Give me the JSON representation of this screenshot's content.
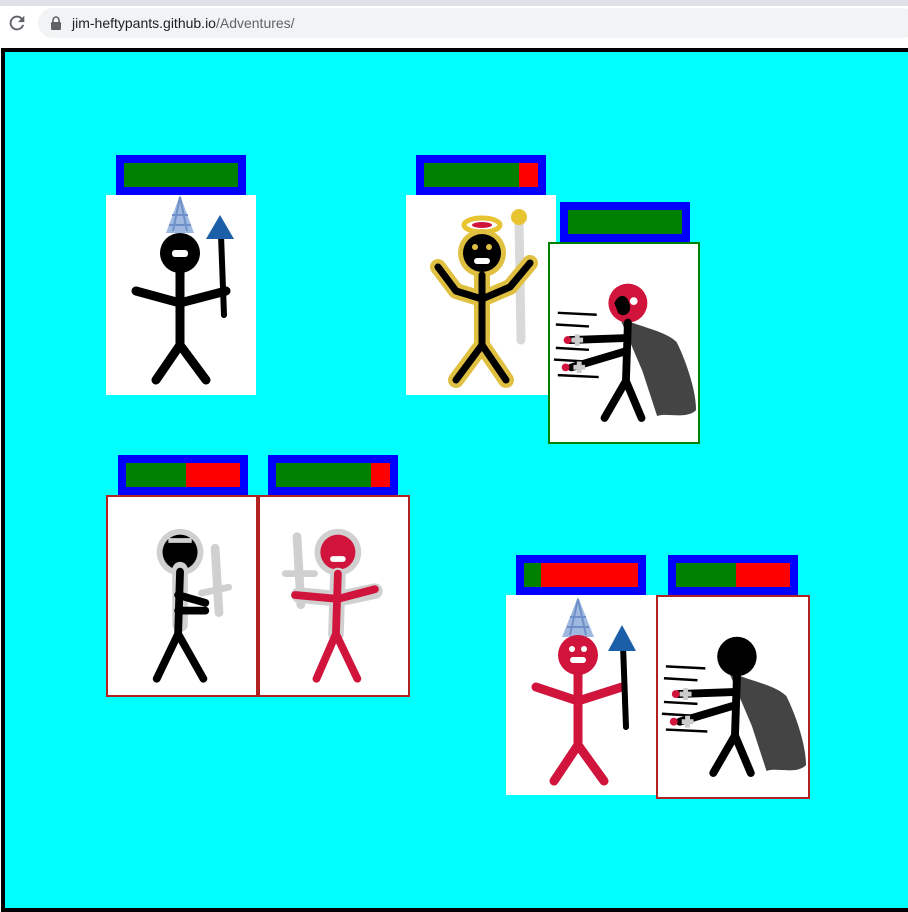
{
  "browser": {
    "url_host": "jim-heftypants.github.io",
    "url_path": "/Adventures/",
    "reload_icon": "reload-icon",
    "lock_icon": "lock-icon"
  },
  "colors": {
    "background": "#00ffff",
    "health": "#008000",
    "damage": "#ff0000",
    "bar_border": "#0000ff",
    "player": "#000000",
    "enemy": "#d0143c",
    "selected_ally": "#008000",
    "targeted": "#b22222"
  },
  "units": [
    {
      "id": "player-wizard",
      "team": "player",
      "role": "wizard",
      "health_fraction": 1.0
    },
    {
      "id": "player-cleric",
      "team": "player",
      "role": "cleric",
      "health_fraction": 0.83
    },
    {
      "id": "player-necromancer",
      "team": "player",
      "role": "necromancer",
      "health_fraction": 1.0,
      "state": "selected"
    },
    {
      "id": "player-knight",
      "team": "player",
      "role": "knight",
      "health_fraction": 0.53,
      "state": "targeted"
    },
    {
      "id": "enemy-knight",
      "team": "enemy",
      "role": "knight",
      "health_fraction": 0.83,
      "state": "targeted"
    },
    {
      "id": "enemy-wizard",
      "team": "enemy",
      "role": "wizard",
      "health_fraction": 0.15
    },
    {
      "id": "enemy-necromancer",
      "team": "enemy",
      "role": "necromancer",
      "health_fraction": 0.53,
      "state": "targeted"
    }
  ]
}
